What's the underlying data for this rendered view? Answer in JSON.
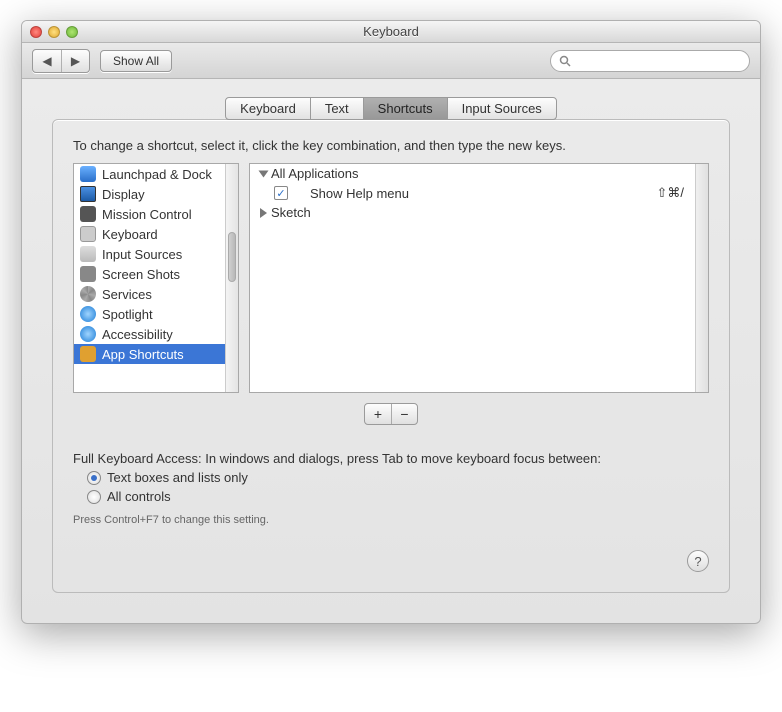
{
  "window": {
    "title": "Keyboard"
  },
  "toolbar": {
    "back": "◀",
    "forward": "▶",
    "show_all": "Show All",
    "search_placeholder": ""
  },
  "tabs": [
    {
      "label": "Keyboard",
      "active": false
    },
    {
      "label": "Text",
      "active": false
    },
    {
      "label": "Shortcuts",
      "active": true
    },
    {
      "label": "Input Sources",
      "active": false
    }
  ],
  "instruction": "To change a shortcut, select it, click the key combination, and then type the new keys.",
  "categories": [
    {
      "label": "Launchpad & Dock",
      "icon": "launchpad-icon",
      "selected": false
    },
    {
      "label": "Display",
      "icon": "display-icon",
      "selected": false
    },
    {
      "label": "Mission Control",
      "icon": "mission-control-icon",
      "selected": false
    },
    {
      "label": "Keyboard",
      "icon": "keyboard-icon",
      "selected": false
    },
    {
      "label": "Input Sources",
      "icon": "input-sources-icon",
      "selected": false
    },
    {
      "label": "Screen Shots",
      "icon": "screen-shots-icon",
      "selected": false
    },
    {
      "label": "Services",
      "icon": "services-icon",
      "selected": false
    },
    {
      "label": "Spotlight",
      "icon": "spotlight-icon",
      "selected": false
    },
    {
      "label": "Accessibility",
      "icon": "accessibility-icon",
      "selected": false
    },
    {
      "label": "App Shortcuts",
      "icon": "app-shortcuts-icon",
      "selected": true
    }
  ],
  "tree": {
    "root": {
      "label": "All Applications",
      "expanded": true,
      "children": [
        {
          "checked": true,
          "label": "Show Help menu",
          "shortcut": "⇧⌘/"
        }
      ]
    },
    "second": {
      "label": "Sketch",
      "expanded": false
    }
  },
  "buttons": {
    "add": "+",
    "remove": "−"
  },
  "fka": {
    "heading": "Full Keyboard Access: In windows and dialogs, press Tab to move keyboard focus between:",
    "opt1": "Text boxes and lists only",
    "opt2": "All controls",
    "hint": "Press Control+F7 to change this setting."
  },
  "help": "?"
}
